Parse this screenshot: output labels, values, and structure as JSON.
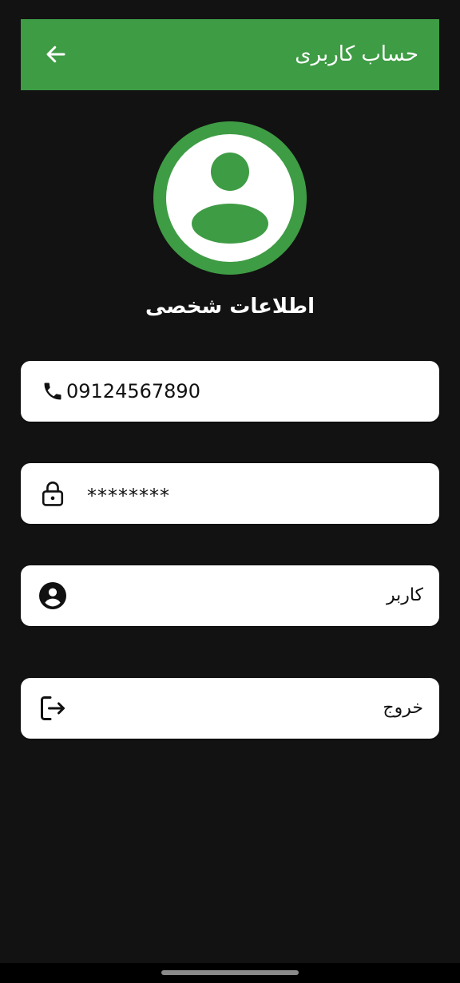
{
  "header": {
    "title": "حساب کاربری"
  },
  "profile": {
    "section_title": "اطلاعات شخصی"
  },
  "fields": {
    "phone": "09124567890",
    "password": "********",
    "user_type": "کاربر"
  },
  "actions": {
    "logout_label": "خروج"
  },
  "colors": {
    "primary": "#3e9c44",
    "background": "#121212",
    "card": "#ffffff"
  },
  "icons": {
    "back": "arrow-left-icon",
    "avatar": "user-avatar-icon",
    "phone": "phone-icon",
    "password": "lock-icon",
    "user": "account-circle-icon",
    "logout": "logout-icon"
  }
}
